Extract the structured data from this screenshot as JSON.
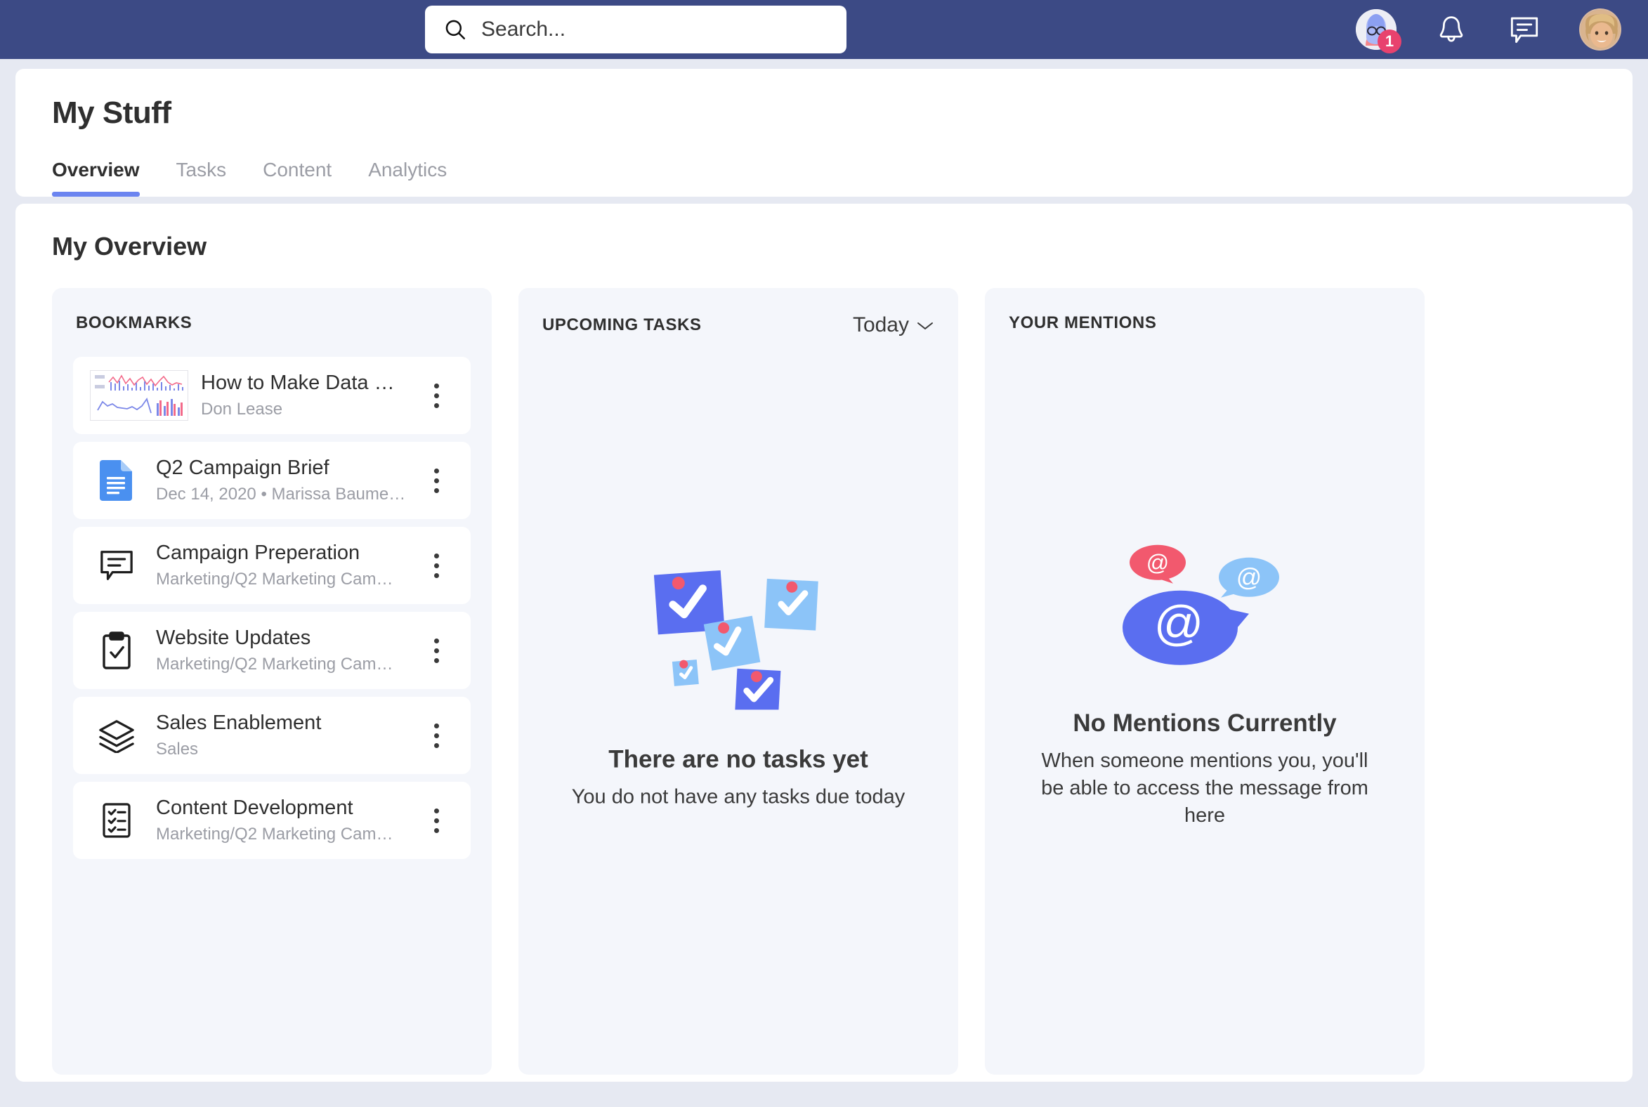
{
  "topbar": {
    "search": {
      "placeholder": "Search...",
      "value": "",
      "icon": "search-icon"
    },
    "notification_badge_count": "1",
    "icons": [
      "profile-avatar-icon",
      "bell-icon",
      "chat-icon",
      "user-avatar"
    ]
  },
  "header": {
    "title": "My Stuff",
    "tabs": [
      {
        "label": "Overview",
        "active": true
      },
      {
        "label": "Tasks",
        "active": false
      },
      {
        "label": "Content",
        "active": false
      },
      {
        "label": "Analytics",
        "active": false
      }
    ]
  },
  "main": {
    "section_title": "My Overview",
    "bookmarks": {
      "label": "BOOKMARKS",
      "items": [
        {
          "title": "How to Make Data …",
          "subtitle": "Don Lease",
          "icon": "dashboard-thumbnail"
        },
        {
          "title": "Q2 Campaign Brief",
          "subtitle": "Dec 14, 2020 • Marissa Baume…",
          "icon": "google-doc-icon"
        },
        {
          "title": "Campaign Preperation",
          "subtitle": "Marketing/Q2 Marketing Cam…",
          "icon": "message-icon"
        },
        {
          "title": "Website Updates",
          "subtitle": "Marketing/Q2 Marketing Cam…",
          "icon": "clipboard-check-icon"
        },
        {
          "title": "Sales Enablement",
          "subtitle": "Sales",
          "icon": "layers-icon"
        },
        {
          "title": "Content Development",
          "subtitle": "Marketing/Q2 Marketing Cam…",
          "icon": "checklist-icon"
        }
      ]
    },
    "tasks": {
      "label": "UPCOMING TASKS",
      "filter": "Today",
      "filter_icon": "chevron-down-icon",
      "empty_title": "There are no tasks yet",
      "empty_text": "You do not have any tasks due today",
      "empty_art": "sticky-notes-checkmarks"
    },
    "mentions": {
      "label": "YOUR MENTIONS",
      "empty_title": "No Mentions Currently",
      "empty_text": "When someone mentions you, you'll be able to access the message from here",
      "empty_art": "at-speech-bubbles"
    }
  },
  "colors": {
    "topbar": "#3c4a85",
    "page_bg": "#e6e9f2",
    "accent": "#6b84f0",
    "panel_bg": "#f4f6fb",
    "badge": "#e8426e",
    "light_blue": "#8cc4f8",
    "muted_text": "#9b9da5"
  }
}
